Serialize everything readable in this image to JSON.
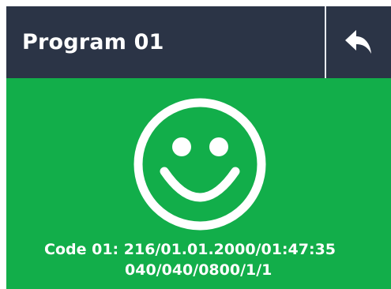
{
  "header": {
    "title": "Program 01",
    "back_icon": "reply-arrow-icon"
  },
  "status": {
    "icon": "smiley-face-icon",
    "background_color": "#12ae4a"
  },
  "code": {
    "line1": "Code 01: 216/01.01.2000/01:47:35",
    "line2": "040/040/0800/1/1"
  },
  "colors": {
    "header_bg": "#2b3446",
    "text": "#ffffff"
  }
}
